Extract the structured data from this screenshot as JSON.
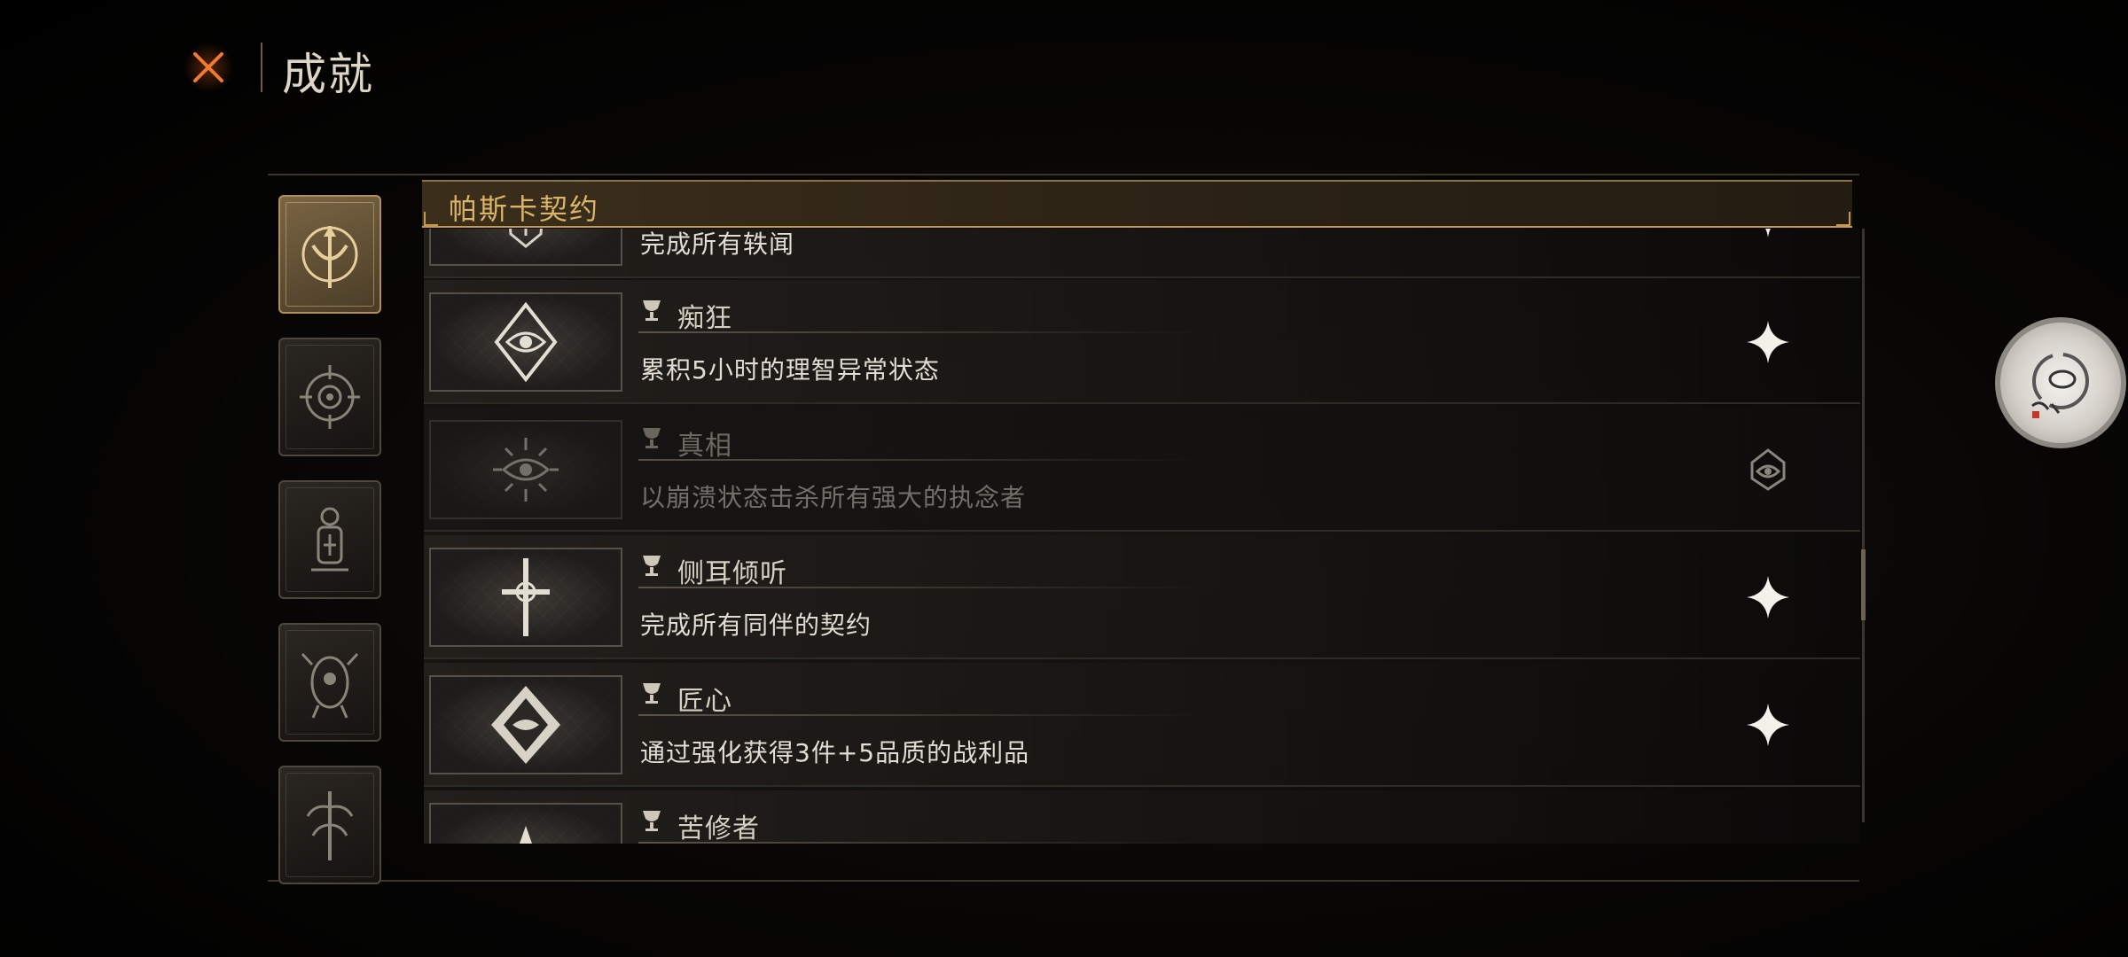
{
  "header": {
    "title": "成就",
    "close_icon": "close-x-icon",
    "accent_color": "#e0662a"
  },
  "tabs": [
    {
      "icon": "trident-emblem-icon",
      "active": true
    },
    {
      "icon": "compass-eye-icon",
      "active": false
    },
    {
      "icon": "lantern-idol-icon",
      "active": false
    },
    {
      "icon": "demon-mask-icon",
      "active": false
    },
    {
      "icon": "twisted-tree-icon",
      "active": false
    }
  ],
  "category": {
    "title": "帕斯卡契约",
    "title_color": "#d9b46b"
  },
  "achievements": [
    {
      "name": "",
      "description": "完成所有轶闻",
      "badge_icon": "shield-crest-icon",
      "state": "completed",
      "state_icon": "sparkle-icon",
      "partial": true
    },
    {
      "name": "痴狂",
      "description": "累积5小时的理智异常状态",
      "badge_icon": "diamond-eye-icon",
      "state": "completed",
      "state_icon": "sparkle-icon"
    },
    {
      "name": "真相",
      "description": "以崩溃状态击杀所有强大的执念者",
      "badge_icon": "radiant-eye-icon",
      "state": "locked",
      "state_icon": "locked-emblem-icon"
    },
    {
      "name": "侧耳倾听",
      "description": "完成所有同伴的契约",
      "badge_icon": "cross-icon",
      "state": "completed",
      "state_icon": "sparkle-icon"
    },
    {
      "name": "匠心",
      "description": "通过强化获得3件+5品质的战利品",
      "badge_icon": "diamond-sunburst-icon",
      "state": "completed",
      "state_icon": "sparkle-icon"
    },
    {
      "name": "苦修者",
      "description": "",
      "badge_icon": "spike-icon",
      "state": "completed",
      "state_icon": "sparkle-icon",
      "partial": true
    }
  ],
  "floating_button": {
    "icon": "ink-seal-icon"
  }
}
